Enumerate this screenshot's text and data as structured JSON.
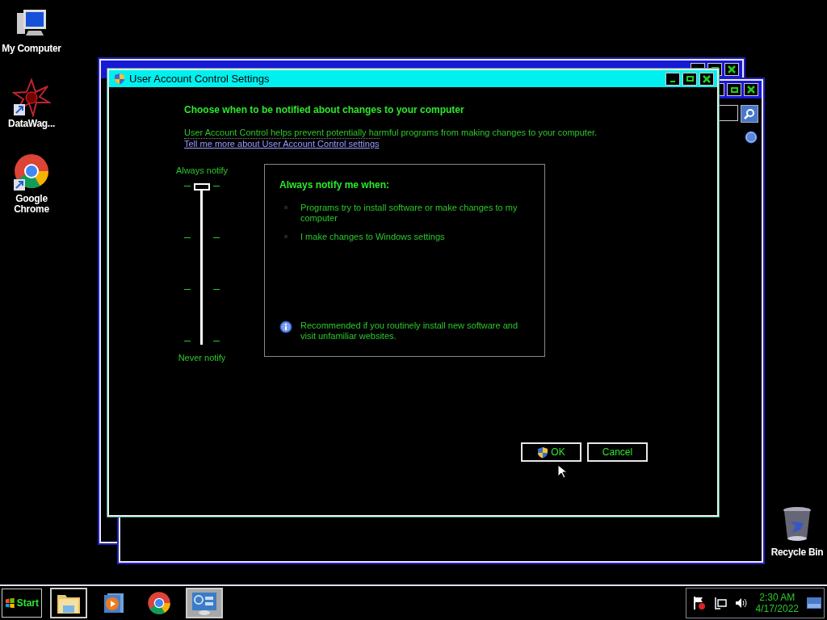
{
  "desktop_icons": [
    {
      "label": "My Computer",
      "kind": "computer"
    },
    {
      "label": "DataWag...",
      "kind": "datawag"
    },
    {
      "label": "Google Chrome",
      "kind": "chrome"
    }
  ],
  "recycle_bin": {
    "label": "Recycle Bin"
  },
  "dialog": {
    "title": "User Account Control Settings",
    "heading": "Choose when to be notified about changes to your computer",
    "description": "User Account Control helps prevent potentially harmful programs from making changes to your computer.",
    "link": "Tell me more about User Account Control settings",
    "slider": {
      "top_label": "Always notify",
      "bottom_label": "Never notify",
      "level": 1
    },
    "panel": {
      "title": "Always notify me when:",
      "items": [
        "Programs try to install software or make changes to my computer",
        "I make changes to Windows settings"
      ],
      "note": "Recommended if you routinely install new software and visit unfamiliar websites."
    },
    "buttons": [
      {
        "label": "OK",
        "shield": true
      },
      {
        "label": "Cancel",
        "shield": false
      }
    ]
  },
  "taskbar": {
    "start": "Start",
    "apps": [
      {
        "kind": "explorer",
        "open": true,
        "selected": false
      },
      {
        "kind": "media",
        "open": false,
        "selected": false
      },
      {
        "kind": "chrome",
        "open": false,
        "selected": false
      },
      {
        "kind": "control-panel",
        "open": true,
        "selected": true
      }
    ],
    "clock": {
      "time": "2:30 AM",
      "date": "4/17/2022"
    }
  }
}
